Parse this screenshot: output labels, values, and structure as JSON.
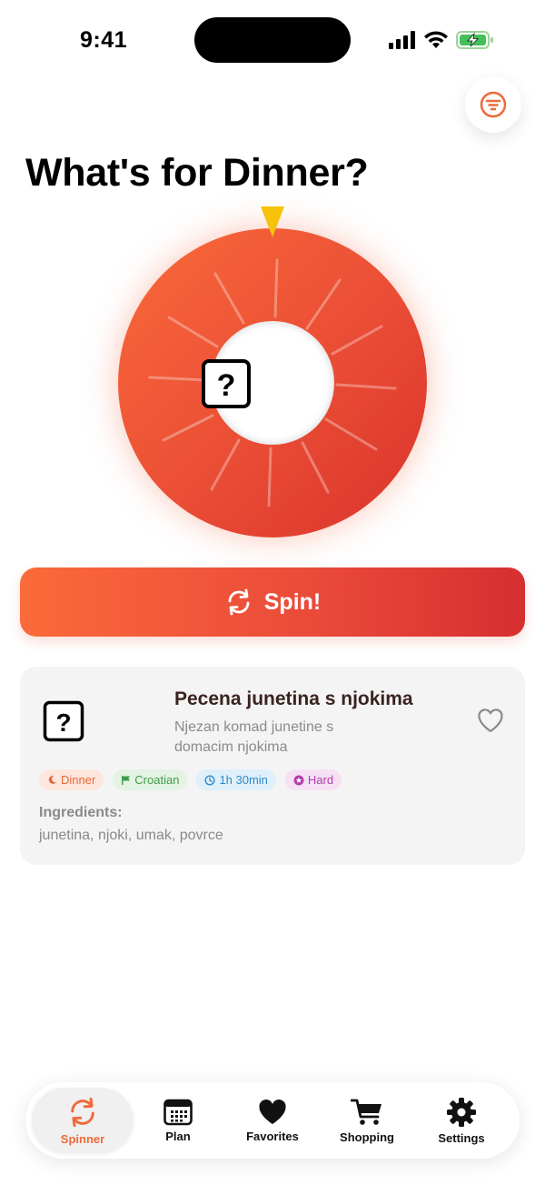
{
  "status_bar": {
    "time": "9:41",
    "icons": [
      "cellular-signal-icon",
      "wifi-icon",
      "battery-charging-icon"
    ]
  },
  "header": {
    "title": "What's for Dinner?",
    "filter_icon": "filter-lines-icon"
  },
  "wheel": {
    "center_icon": "question-mark-square-icon",
    "pointer_color": "#f6c30a"
  },
  "spin_button": {
    "label": "Spin!",
    "icon": "refresh-arrows-icon"
  },
  "recipe_card": {
    "title": "Pecena junetina s njokima",
    "description": "Njezan komad junetine s domacim njokima",
    "favorite_icon": "heart-outline-icon",
    "tags": {
      "meal": "Dinner",
      "cuisine": "Croatian",
      "time": "1h 30min",
      "difficulty": "Hard"
    },
    "ingredients_label": "Ingredients:",
    "ingredients": "junetina, njoki, umak, povrce"
  },
  "tab_bar": {
    "tabs": [
      {
        "label": "Spinner",
        "icon": "refresh-arrows-icon",
        "active": true
      },
      {
        "label": "Plan",
        "icon": "calendar-icon",
        "active": false
      },
      {
        "label": "Favorites",
        "icon": "heart-icon",
        "active": false
      },
      {
        "label": "Shopping",
        "icon": "cart-icon",
        "active": false
      },
      {
        "label": "Settings",
        "icon": "gear-icon",
        "active": false
      }
    ]
  },
  "colors": {
    "accent": "#ef6a3a",
    "accent_dark": "#d52f30",
    "text_primary": "#111111",
    "text_secondary": "#8a8a8a"
  }
}
